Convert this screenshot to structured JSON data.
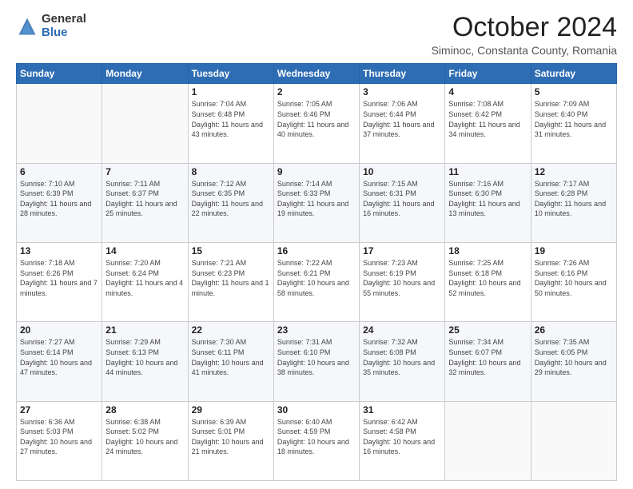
{
  "logo": {
    "general": "General",
    "blue": "Blue"
  },
  "title": "October 2024",
  "location": "Siminoc, Constanta County, Romania",
  "days_of_week": [
    "Sunday",
    "Monday",
    "Tuesday",
    "Wednesday",
    "Thursday",
    "Friday",
    "Saturday"
  ],
  "weeks": [
    [
      {
        "day": "",
        "sunrise": "",
        "sunset": "",
        "daylight": ""
      },
      {
        "day": "",
        "sunrise": "",
        "sunset": "",
        "daylight": ""
      },
      {
        "day": "1",
        "sunrise": "Sunrise: 7:04 AM",
        "sunset": "Sunset: 6:48 PM",
        "daylight": "Daylight: 11 hours and 43 minutes."
      },
      {
        "day": "2",
        "sunrise": "Sunrise: 7:05 AM",
        "sunset": "Sunset: 6:46 PM",
        "daylight": "Daylight: 11 hours and 40 minutes."
      },
      {
        "day": "3",
        "sunrise": "Sunrise: 7:06 AM",
        "sunset": "Sunset: 6:44 PM",
        "daylight": "Daylight: 11 hours and 37 minutes."
      },
      {
        "day": "4",
        "sunrise": "Sunrise: 7:08 AM",
        "sunset": "Sunset: 6:42 PM",
        "daylight": "Daylight: 11 hours and 34 minutes."
      },
      {
        "day": "5",
        "sunrise": "Sunrise: 7:09 AM",
        "sunset": "Sunset: 6:40 PM",
        "daylight": "Daylight: 11 hours and 31 minutes."
      }
    ],
    [
      {
        "day": "6",
        "sunrise": "Sunrise: 7:10 AM",
        "sunset": "Sunset: 6:39 PM",
        "daylight": "Daylight: 11 hours and 28 minutes."
      },
      {
        "day": "7",
        "sunrise": "Sunrise: 7:11 AM",
        "sunset": "Sunset: 6:37 PM",
        "daylight": "Daylight: 11 hours and 25 minutes."
      },
      {
        "day": "8",
        "sunrise": "Sunrise: 7:12 AM",
        "sunset": "Sunset: 6:35 PM",
        "daylight": "Daylight: 11 hours and 22 minutes."
      },
      {
        "day": "9",
        "sunrise": "Sunrise: 7:14 AM",
        "sunset": "Sunset: 6:33 PM",
        "daylight": "Daylight: 11 hours and 19 minutes."
      },
      {
        "day": "10",
        "sunrise": "Sunrise: 7:15 AM",
        "sunset": "Sunset: 6:31 PM",
        "daylight": "Daylight: 11 hours and 16 minutes."
      },
      {
        "day": "11",
        "sunrise": "Sunrise: 7:16 AM",
        "sunset": "Sunset: 6:30 PM",
        "daylight": "Daylight: 11 hours and 13 minutes."
      },
      {
        "day": "12",
        "sunrise": "Sunrise: 7:17 AM",
        "sunset": "Sunset: 6:28 PM",
        "daylight": "Daylight: 11 hours and 10 minutes."
      }
    ],
    [
      {
        "day": "13",
        "sunrise": "Sunrise: 7:18 AM",
        "sunset": "Sunset: 6:26 PM",
        "daylight": "Daylight: 11 hours and 7 minutes."
      },
      {
        "day": "14",
        "sunrise": "Sunrise: 7:20 AM",
        "sunset": "Sunset: 6:24 PM",
        "daylight": "Daylight: 11 hours and 4 minutes."
      },
      {
        "day": "15",
        "sunrise": "Sunrise: 7:21 AM",
        "sunset": "Sunset: 6:23 PM",
        "daylight": "Daylight: 11 hours and 1 minute."
      },
      {
        "day": "16",
        "sunrise": "Sunrise: 7:22 AM",
        "sunset": "Sunset: 6:21 PM",
        "daylight": "Daylight: 10 hours and 58 minutes."
      },
      {
        "day": "17",
        "sunrise": "Sunrise: 7:23 AM",
        "sunset": "Sunset: 6:19 PM",
        "daylight": "Daylight: 10 hours and 55 minutes."
      },
      {
        "day": "18",
        "sunrise": "Sunrise: 7:25 AM",
        "sunset": "Sunset: 6:18 PM",
        "daylight": "Daylight: 10 hours and 52 minutes."
      },
      {
        "day": "19",
        "sunrise": "Sunrise: 7:26 AM",
        "sunset": "Sunset: 6:16 PM",
        "daylight": "Daylight: 10 hours and 50 minutes."
      }
    ],
    [
      {
        "day": "20",
        "sunrise": "Sunrise: 7:27 AM",
        "sunset": "Sunset: 6:14 PM",
        "daylight": "Daylight: 10 hours and 47 minutes."
      },
      {
        "day": "21",
        "sunrise": "Sunrise: 7:29 AM",
        "sunset": "Sunset: 6:13 PM",
        "daylight": "Daylight: 10 hours and 44 minutes."
      },
      {
        "day": "22",
        "sunrise": "Sunrise: 7:30 AM",
        "sunset": "Sunset: 6:11 PM",
        "daylight": "Daylight: 10 hours and 41 minutes."
      },
      {
        "day": "23",
        "sunrise": "Sunrise: 7:31 AM",
        "sunset": "Sunset: 6:10 PM",
        "daylight": "Daylight: 10 hours and 38 minutes."
      },
      {
        "day": "24",
        "sunrise": "Sunrise: 7:32 AM",
        "sunset": "Sunset: 6:08 PM",
        "daylight": "Daylight: 10 hours and 35 minutes."
      },
      {
        "day": "25",
        "sunrise": "Sunrise: 7:34 AM",
        "sunset": "Sunset: 6:07 PM",
        "daylight": "Daylight: 10 hours and 32 minutes."
      },
      {
        "day": "26",
        "sunrise": "Sunrise: 7:35 AM",
        "sunset": "Sunset: 6:05 PM",
        "daylight": "Daylight: 10 hours and 29 minutes."
      }
    ],
    [
      {
        "day": "27",
        "sunrise": "Sunrise: 6:36 AM",
        "sunset": "Sunset: 5:03 PM",
        "daylight": "Daylight: 10 hours and 27 minutes."
      },
      {
        "day": "28",
        "sunrise": "Sunrise: 6:38 AM",
        "sunset": "Sunset: 5:02 PM",
        "daylight": "Daylight: 10 hours and 24 minutes."
      },
      {
        "day": "29",
        "sunrise": "Sunrise: 6:39 AM",
        "sunset": "Sunset: 5:01 PM",
        "daylight": "Daylight: 10 hours and 21 minutes."
      },
      {
        "day": "30",
        "sunrise": "Sunrise: 6:40 AM",
        "sunset": "Sunset: 4:59 PM",
        "daylight": "Daylight: 10 hours and 18 minutes."
      },
      {
        "day": "31",
        "sunrise": "Sunrise: 6:42 AM",
        "sunset": "Sunset: 4:58 PM",
        "daylight": "Daylight: 10 hours and 16 minutes."
      },
      {
        "day": "",
        "sunrise": "",
        "sunset": "",
        "daylight": ""
      },
      {
        "day": "",
        "sunrise": "",
        "sunset": "",
        "daylight": ""
      }
    ]
  ]
}
